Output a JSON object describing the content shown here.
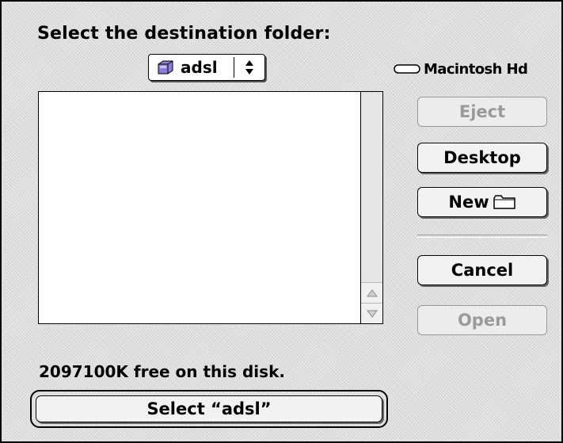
{
  "dialog": {
    "title": "Select the destination folder:",
    "folder_popup": {
      "label": "adsl",
      "icon": "folder-icon"
    },
    "volume": {
      "label": "Macintosh Hd",
      "icon": "hard-disk-icon"
    },
    "file_list": {
      "items": []
    },
    "buttons": {
      "eject": "Eject",
      "desktop": "Desktop",
      "new": "New",
      "cancel": "Cancel",
      "open": "Open"
    },
    "free_space": "2097100K free on this disk.",
    "select_button": "Select “adsl”"
  },
  "colors": {
    "background": "#dedede",
    "disabled_text": "#9a9a9a",
    "folder_purple": "#8a7fd6"
  }
}
